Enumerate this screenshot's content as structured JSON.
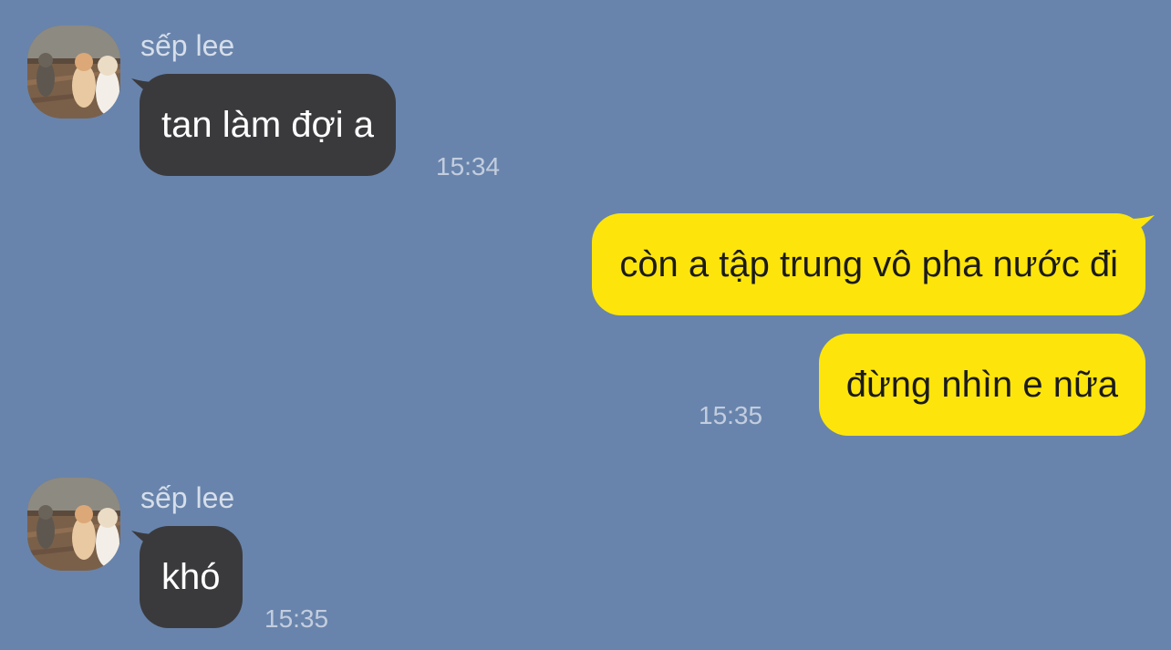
{
  "theme": {
    "background": "#6884ac",
    "incoming_bubble": "#3a3a3d",
    "outgoing_bubble": "#fde50b",
    "sender_color": "#d6deea",
    "time_color": "#c3cdde"
  },
  "messages": [
    {
      "direction": "incoming",
      "sender": "sếp lee",
      "avatar_icon": "cats-photo-avatar",
      "text": "tan làm đợi a",
      "time": "15:34"
    },
    {
      "direction": "outgoing",
      "text": "còn a tập trung vô pha nước đi",
      "time": ""
    },
    {
      "direction": "outgoing",
      "text": "đừng nhìn e nữa",
      "time": "15:35"
    },
    {
      "direction": "incoming",
      "sender": "sếp lee",
      "avatar_icon": "cats-photo-avatar",
      "text": "khó",
      "time": "15:35"
    }
  ]
}
